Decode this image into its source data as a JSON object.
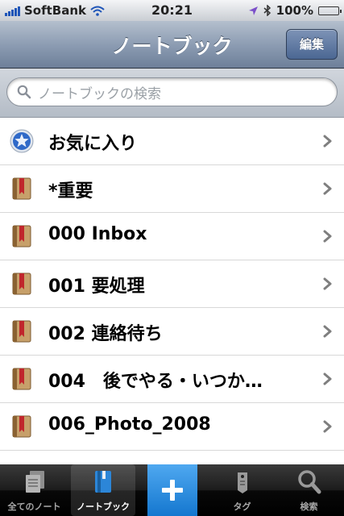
{
  "status": {
    "carrier": "SoftBank",
    "time": "20:21",
    "battery": "100%"
  },
  "nav": {
    "title": "ノートブック",
    "edit_label": "編集"
  },
  "search": {
    "placeholder": "ノートブックの検索"
  },
  "notebooks": [
    {
      "label": "お気に入り",
      "icon": "star-icon"
    },
    {
      "label": "*重要",
      "icon": "notebook-icon"
    },
    {
      "label": "000 Inbox",
      "icon": "notebook-icon"
    },
    {
      "label": "001 要処理",
      "icon": "notebook-icon"
    },
    {
      "label": "002 連絡待ち",
      "icon": "notebook-icon"
    },
    {
      "label": "004　後でやる・いつか…",
      "icon": "notebook-icon"
    },
    {
      "label": "006_Photo_2008",
      "icon": "notebook-icon"
    }
  ],
  "tabs": {
    "all_notes": "全てのノート",
    "notebooks": "ノートブック",
    "add": "+",
    "tags": "タグ",
    "search": "検索"
  },
  "colors": {
    "nav_bar": "#7d8ea6",
    "tab_accent": "#1f86de",
    "notebook_red": "#c0262c",
    "star_blue": "#2f69c8"
  }
}
